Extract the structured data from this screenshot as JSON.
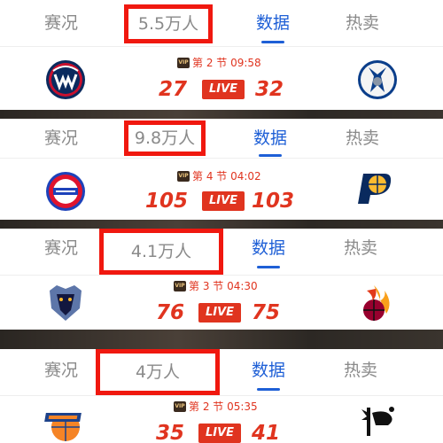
{
  "tabs": [
    {
      "label": "赛况"
    },
    {
      "label": "数据"
    },
    {
      "label": "热卖"
    }
  ],
  "live_label": "LIVE",
  "vip_label": "VIP",
  "accent_color": "#1e5fd6",
  "score_color": "#e0341f",
  "highlight_color": "#f0180f",
  "cards": [
    {
      "viewers": "5.5万人",
      "period": "第 2 节 09:58",
      "home": {
        "team_icon": "wizards-logo-icon",
        "score": "27"
      },
      "away": {
        "team_icon": "mavericks-logo-icon",
        "score": "32"
      }
    },
    {
      "viewers": "9.8万人",
      "period": "第 4 节 04:02",
      "home": {
        "team_icon": "pistons-logo-icon",
        "score": "105"
      },
      "away": {
        "team_icon": "pacers-logo-icon",
        "score": "103"
      }
    },
    {
      "viewers": "4.1万人",
      "period": "第 3 节 04:30",
      "home": {
        "team_icon": "grizzlies-logo-icon",
        "score": "76"
      },
      "away": {
        "team_icon": "heat-logo-icon",
        "score": "75"
      }
    },
    {
      "viewers": "4万人",
      "period": "第 2 节 05:35",
      "home": {
        "team_icon": "knicks-logo-icon",
        "score": "35"
      },
      "away": {
        "team_icon": "spurs-logo-icon",
        "score": "41"
      }
    }
  ]
}
